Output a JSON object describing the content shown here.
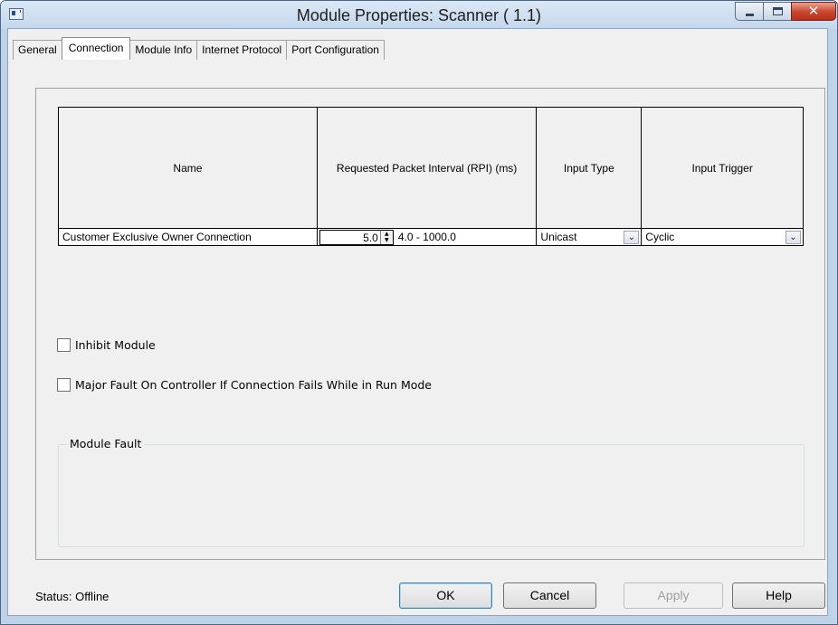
{
  "window": {
    "title": "Module Properties: Scanner ( 1.1)",
    "close_glyph": "✕"
  },
  "tabs": [
    {
      "label": "General"
    },
    {
      "label": "Connection"
    },
    {
      "label": "Module Info"
    },
    {
      "label": "Internet Protocol"
    },
    {
      "label": "Port Configuration"
    }
  ],
  "active_tab": "Connection",
  "connection_table": {
    "headers": {
      "name": "Name",
      "rpi": "Requested Packet Interval (RPI) (ms)",
      "input_type": "Input Type",
      "input_trigger": "Input Trigger"
    },
    "rows": [
      {
        "name": "Customer Exclusive Owner Connection",
        "rpi_value": "5.0",
        "rpi_range": "4.0 - 1000.0",
        "input_type": "Unicast",
        "input_trigger": "Cyclic"
      }
    ]
  },
  "checkboxes": {
    "inhibit_module": {
      "label": "Inhibit Module",
      "checked": false
    },
    "major_fault": {
      "label": "Major Fault On Controller If Connection Fails While in Run Mode",
      "checked": false
    }
  },
  "module_fault": {
    "label": "Module Fault"
  },
  "status": {
    "text": "Status:  Offline"
  },
  "buttons": {
    "ok": "OK",
    "cancel": "Cancel",
    "apply": "Apply",
    "help": "Help"
  }
}
